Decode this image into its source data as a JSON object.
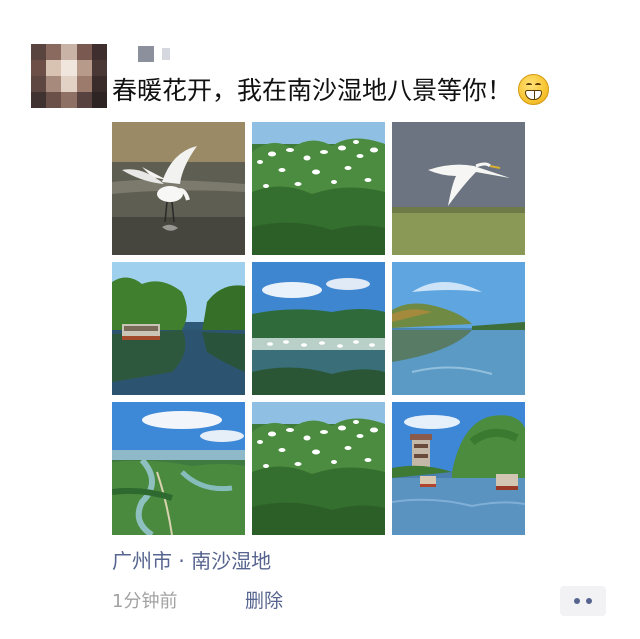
{
  "post": {
    "text": "春暖花开，我在南沙湿地八景等你！",
    "emoji_icon": "grinning-face-icon",
    "location": "广州市 · 南沙湿地",
    "timestamp": "1分钟前",
    "delete_label": "删除",
    "more_icon": "more-dots-icon"
  },
  "colors": {
    "link": "#56648f",
    "timestamp": "#a2a2a2",
    "text": "#111111"
  },
  "photos": [
    {
      "icon": "egret-landing-photo"
    },
    {
      "icon": "egrets-in-trees-photo"
    },
    {
      "icon": "egret-in-flight-photo"
    },
    {
      "icon": "river-boat-photo"
    },
    {
      "icon": "wetland-lake-photo"
    },
    {
      "icon": "reed-shore-lake-photo"
    },
    {
      "icon": "aerial-wetland-photo"
    },
    {
      "icon": "egrets-in-trees-photo"
    },
    {
      "icon": "tower-and-boats-photo"
    }
  ]
}
